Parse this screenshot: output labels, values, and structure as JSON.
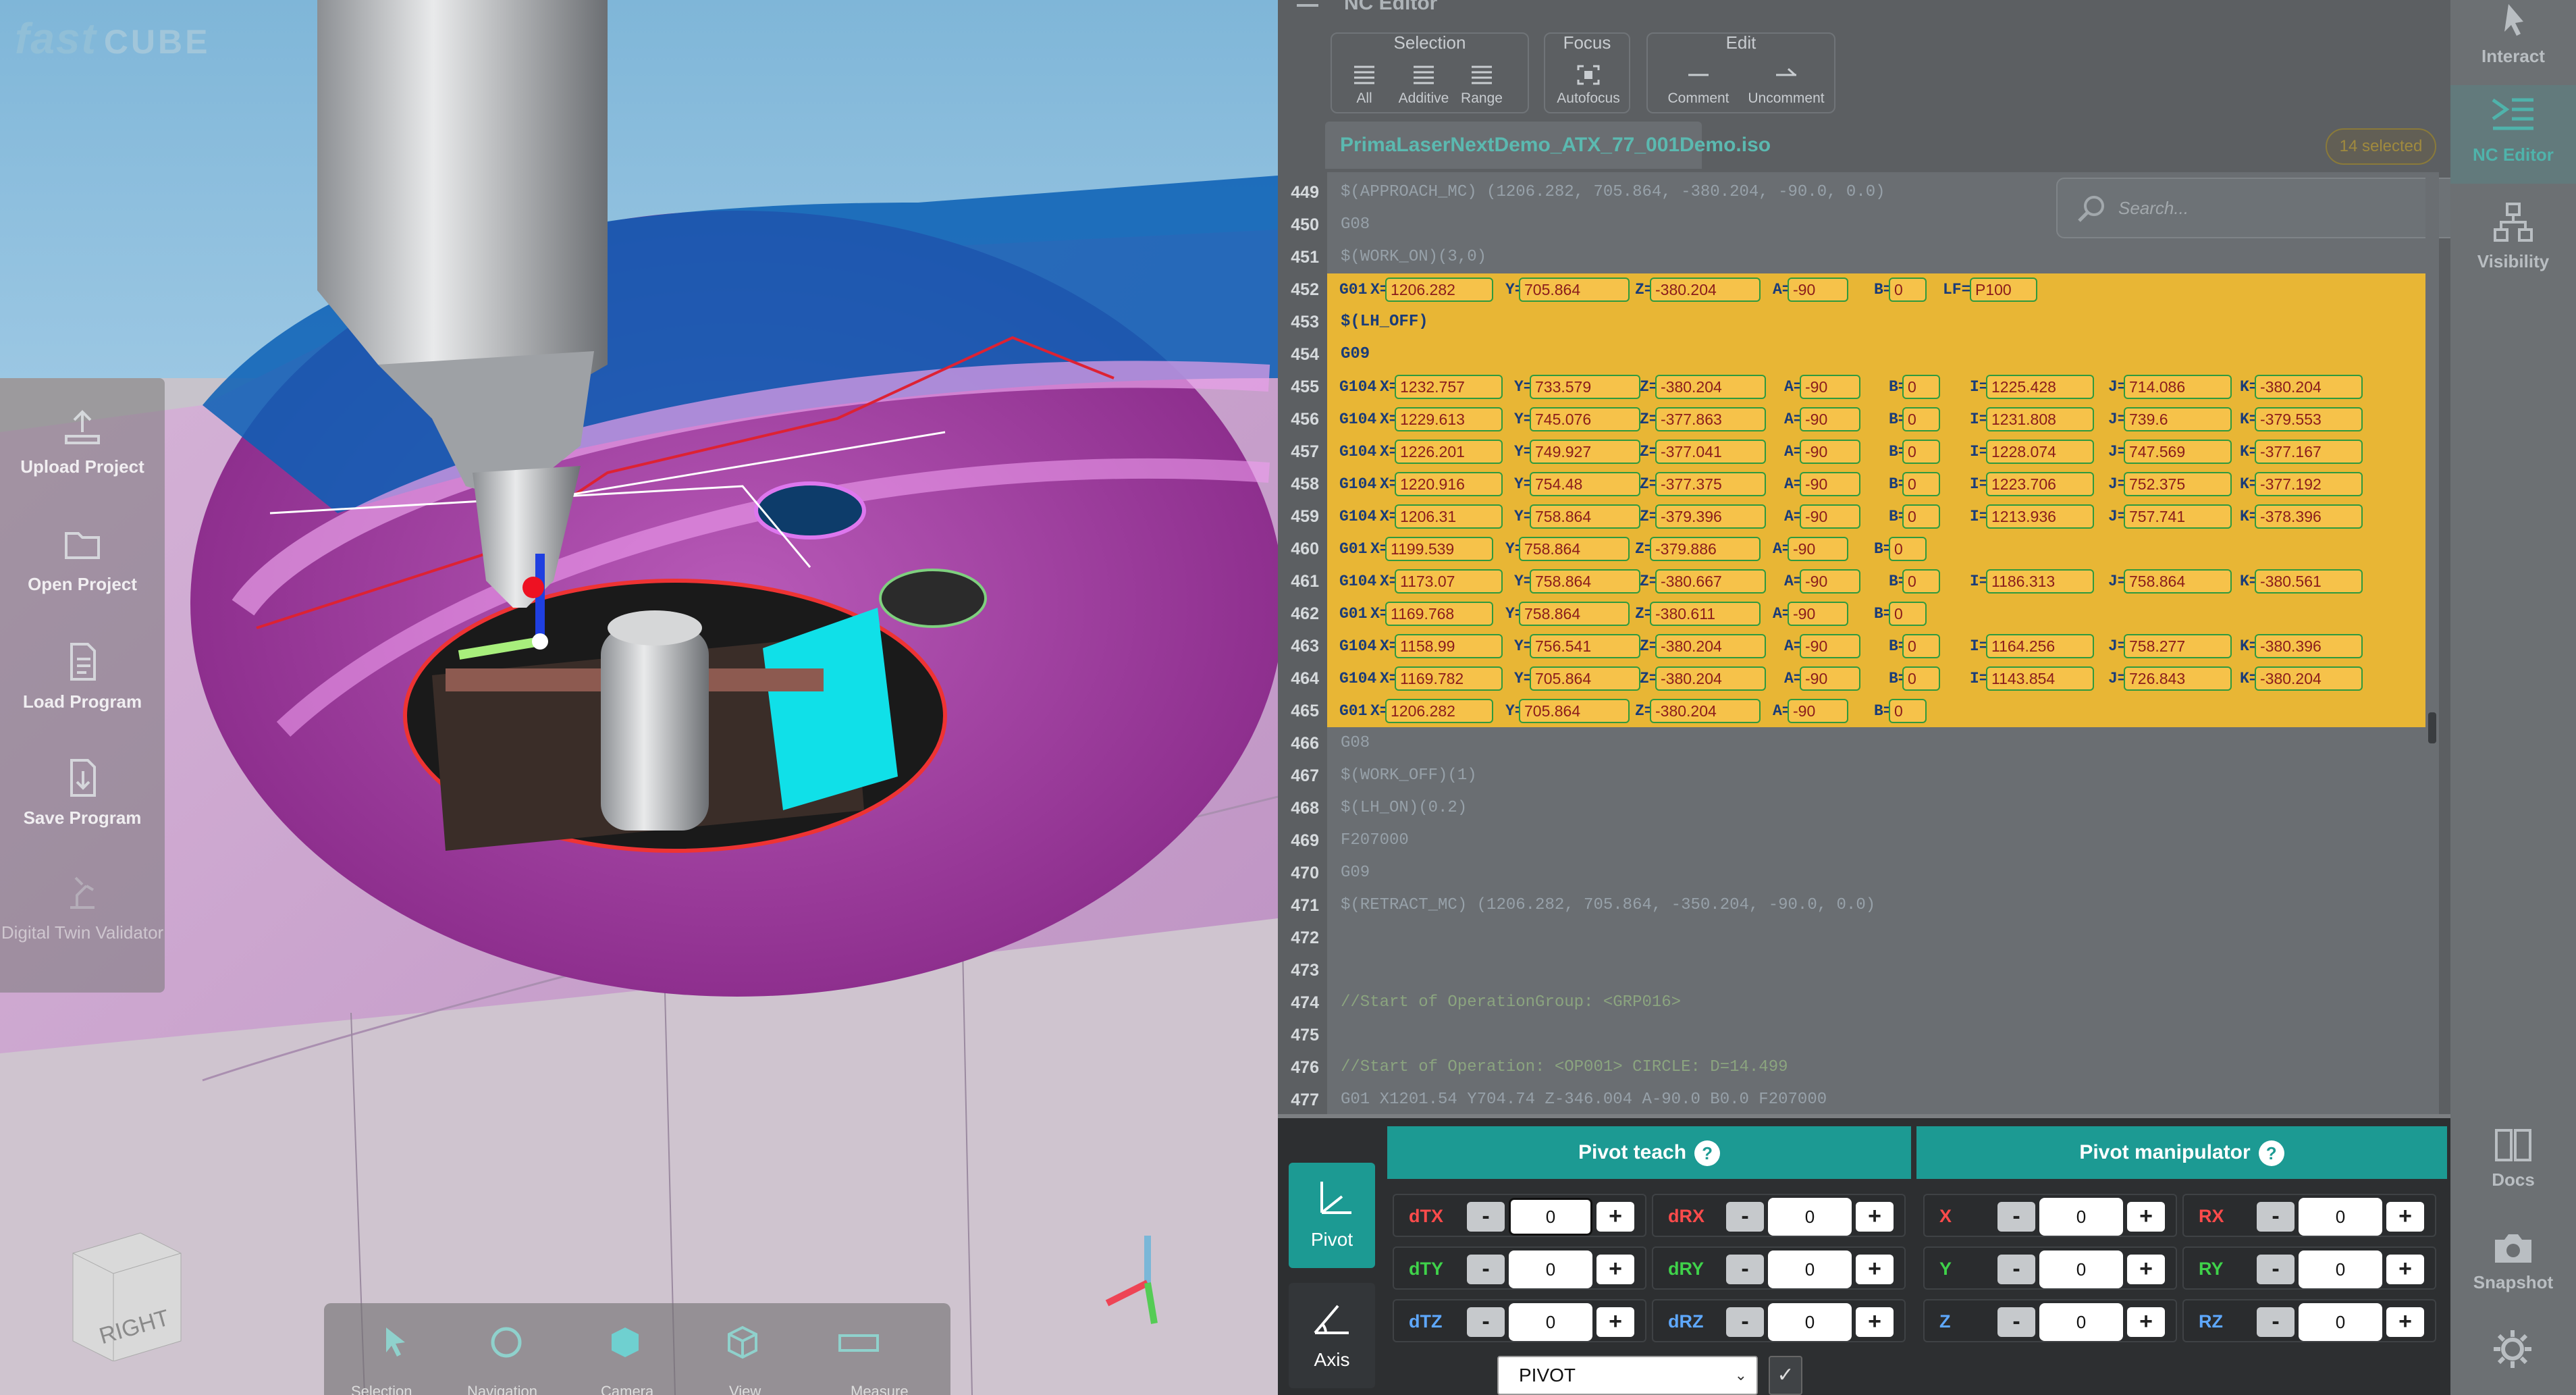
{
  "brand": {
    "name": "fast",
    "suffix": "CUBE"
  },
  "left_sidebar": {
    "items": [
      {
        "label": "Upload Project",
        "icon": "upload-icon"
      },
      {
        "label": "Open Project",
        "icon": "folder-icon"
      },
      {
        "label": "Load Program",
        "icon": "document-icon"
      },
      {
        "label": "Save Program",
        "icon": "save-icon"
      },
      {
        "label": "Digital Twin Validator",
        "icon": "robot-icon",
        "disabled": true
      }
    ]
  },
  "view_cube": {
    "face_label": "RIGHT"
  },
  "nc_editor": {
    "title": "NC Editor",
    "ribbon": {
      "groups": [
        {
          "title": "Selection",
          "buttons": [
            "All",
            "Additive",
            "Range"
          ]
        },
        {
          "title": "Focus",
          "buttons": [
            "Autofocus"
          ]
        },
        {
          "title": "Edit",
          "buttons": [
            "Comment",
            "Uncomment"
          ]
        }
      ]
    },
    "file_tab": "PrimaLaserNextDemo_ATX_77_001Demo.iso",
    "selected_badge": "14 selected",
    "search_placeholder": "Search...",
    "lines": [
      {
        "n": "449",
        "text": "$(APPROACH_MC) (1206.282, 705.864, -380.204, -90.0, 0.0)",
        "type": "plain"
      },
      {
        "n": "450",
        "text": "G08",
        "type": "plain"
      },
      {
        "n": "451",
        "text": "$(WORK_ON)(3,0)",
        "type": "plain"
      },
      {
        "n": "452",
        "cmd": "G01",
        "params": [
          [
            "X=",
            "1206.282"
          ],
          [
            "Y=",
            "705.864"
          ],
          [
            "Z=",
            "-380.204"
          ],
          [
            "A=",
            "-90"
          ],
          [
            "B=",
            "0"
          ],
          [
            "LF=",
            "P100"
          ]
        ],
        "type": "sel"
      },
      {
        "n": "453",
        "text": "$(LH_OFF)",
        "type": "seltext"
      },
      {
        "n": "454",
        "text": "G09",
        "type": "seltext"
      },
      {
        "n": "455",
        "cmd": "G104",
        "params": [
          [
            "X=",
            "1232.757"
          ],
          [
            "Y=",
            "733.579"
          ],
          [
            "Z=",
            "-380.204"
          ],
          [
            "A=",
            "-90"
          ],
          [
            "B=",
            "0"
          ],
          [
            "I=",
            "1225.428"
          ],
          [
            "J=",
            "714.086"
          ],
          [
            "K=",
            "-380.204"
          ]
        ],
        "type": "sel"
      },
      {
        "n": "456",
        "cmd": "G104",
        "params": [
          [
            "X=",
            "1229.613"
          ],
          [
            "Y=",
            "745.076"
          ],
          [
            "Z=",
            "-377.863"
          ],
          [
            "A=",
            "-90"
          ],
          [
            "B=",
            "0"
          ],
          [
            "I=",
            "1231.808"
          ],
          [
            "J=",
            "739.6"
          ],
          [
            "K=",
            "-379.553"
          ]
        ],
        "type": "sel"
      },
      {
        "n": "457",
        "cmd": "G104",
        "params": [
          [
            "X=",
            "1226.201"
          ],
          [
            "Y=",
            "749.927"
          ],
          [
            "Z=",
            "-377.041"
          ],
          [
            "A=",
            "-90"
          ],
          [
            "B=",
            "0"
          ],
          [
            "I=",
            "1228.074"
          ],
          [
            "J=",
            "747.569"
          ],
          [
            "K=",
            "-377.167"
          ]
        ],
        "type": "sel"
      },
      {
        "n": "458",
        "cmd": "G104",
        "params": [
          [
            "X=",
            "1220.916"
          ],
          [
            "Y=",
            "754.48"
          ],
          [
            "Z=",
            "-377.375"
          ],
          [
            "A=",
            "-90"
          ],
          [
            "B=",
            "0"
          ],
          [
            "I=",
            "1223.706"
          ],
          [
            "J=",
            "752.375"
          ],
          [
            "K=",
            "-377.192"
          ]
        ],
        "type": "sel"
      },
      {
        "n": "459",
        "cmd": "G104",
        "params": [
          [
            "X=",
            "1206.31"
          ],
          [
            "Y=",
            "758.864"
          ],
          [
            "Z=",
            "-379.396"
          ],
          [
            "A=",
            "-90"
          ],
          [
            "B=",
            "0"
          ],
          [
            "I=",
            "1213.936"
          ],
          [
            "J=",
            "757.741"
          ],
          [
            "K=",
            "-378.396"
          ]
        ],
        "type": "sel"
      },
      {
        "n": "460",
        "cmd": "G01",
        "params": [
          [
            "X=",
            "1199.539"
          ],
          [
            "Y=",
            "758.864"
          ],
          [
            "Z=",
            "-379.886"
          ],
          [
            "A=",
            "-90"
          ],
          [
            "B=",
            "0"
          ]
        ],
        "type": "sel"
      },
      {
        "n": "461",
        "cmd": "G104",
        "params": [
          [
            "X=",
            "1173.07"
          ],
          [
            "Y=",
            "758.864"
          ],
          [
            "Z=",
            "-380.667"
          ],
          [
            "A=",
            "-90"
          ],
          [
            "B=",
            "0"
          ],
          [
            "I=",
            "1186.313"
          ],
          [
            "J=",
            "758.864"
          ],
          [
            "K=",
            "-380.561"
          ]
        ],
        "type": "sel"
      },
      {
        "n": "462",
        "cmd": "G01",
        "params": [
          [
            "X=",
            "1169.768"
          ],
          [
            "Y=",
            "758.864"
          ],
          [
            "Z=",
            "-380.611"
          ],
          [
            "A=",
            "-90"
          ],
          [
            "B=",
            "0"
          ]
        ],
        "type": "sel"
      },
      {
        "n": "463",
        "cmd": "G104",
        "params": [
          [
            "X=",
            "1158.99"
          ],
          [
            "Y=",
            "756.541"
          ],
          [
            "Z=",
            "-380.204"
          ],
          [
            "A=",
            "-90"
          ],
          [
            "B=",
            "0"
          ],
          [
            "I=",
            "1164.256"
          ],
          [
            "J=",
            "758.277"
          ],
          [
            "K=",
            "-380.396"
          ]
        ],
        "type": "sel"
      },
      {
        "n": "464",
        "cmd": "G104",
        "params": [
          [
            "X=",
            "1169.782"
          ],
          [
            "Y=",
            "705.864"
          ],
          [
            "Z=",
            "-380.204"
          ],
          [
            "A=",
            "-90"
          ],
          [
            "B=",
            "0"
          ],
          [
            "I=",
            "1143.854"
          ],
          [
            "J=",
            "726.843"
          ],
          [
            "K=",
            "-380.204"
          ]
        ],
        "type": "sel"
      },
      {
        "n": "465",
        "cmd": "G01",
        "params": [
          [
            "X=",
            "1206.282"
          ],
          [
            "Y=",
            "705.864"
          ],
          [
            "Z=",
            "-380.204"
          ],
          [
            "A=",
            "-90"
          ],
          [
            "B=",
            "0"
          ]
        ],
        "type": "sel"
      },
      {
        "n": "466",
        "text": "G08",
        "type": "plain"
      },
      {
        "n": "467",
        "text": "$(WORK_OFF)(1)",
        "type": "plain"
      },
      {
        "n": "468",
        "text": "$(LH_ON)(0.2)",
        "type": "plain"
      },
      {
        "n": "469",
        "text": "F207000",
        "type": "plain"
      },
      {
        "n": "470",
        "text": "G09",
        "type": "plain"
      },
      {
        "n": "471",
        "text": "$(RETRACT_MC) (1206.282, 705.864, -350.204, -90.0, 0.0)",
        "type": "plain"
      },
      {
        "n": "472",
        "text": "",
        "type": "plain"
      },
      {
        "n": "473",
        "text": "",
        "type": "plain"
      },
      {
        "n": "474",
        "text": "//Start of OperationGroup: <GRP016>",
        "type": "comment"
      },
      {
        "n": "475",
        "text": "",
        "type": "plain"
      },
      {
        "n": "476",
        "text": "//Start of Operation: <OP001> CIRCLE: D=14.499",
        "type": "comment"
      },
      {
        "n": "477",
        "text": "G01 X1201.54 Y704.74 Z-346.004 A-90.0 B0.0 F207000",
        "type": "plain"
      }
    ]
  },
  "right_sidebar": {
    "items": [
      {
        "label": "Interact",
        "icon": "cursor-icon"
      },
      {
        "label": "NC Editor",
        "icon": "nc-editor-icon",
        "active": true
      },
      {
        "label": "Visibility",
        "icon": "hierarchy-icon"
      },
      {
        "label": "Docs",
        "icon": "book-icon"
      },
      {
        "label": "Snapshot",
        "icon": "camera-icon"
      }
    ]
  },
  "pivot_panel": {
    "side_buttons": [
      {
        "label": "Pivot",
        "icon": "pivot-icon",
        "active": true
      },
      {
        "label": "Axis",
        "icon": "axis-icon"
      }
    ],
    "teach": {
      "title": "Pivot teach",
      "help": "?",
      "fields": [
        {
          "label": "dTX",
          "value": "0",
          "color": "#ff4b4b"
        },
        {
          "label": "dRX",
          "value": "0",
          "color": "#ff4b4b"
        },
        {
          "label": "dTY",
          "value": "0",
          "color": "#3fd24a"
        },
        {
          "label": "dRY",
          "value": "0",
          "color": "#3fd24a"
        },
        {
          "label": "dTZ",
          "value": "0",
          "color": "#5ea8ff"
        },
        {
          "label": "dRZ",
          "value": "0",
          "color": "#5ea8ff"
        }
      ]
    },
    "manipulator": {
      "title": "Pivot manipulator",
      "help": "?",
      "fields": [
        {
          "label": "X",
          "value": "0",
          "color": "#ff4b4b"
        },
        {
          "label": "RX",
          "value": "0",
          "color": "#ff4b4b"
        },
        {
          "label": "Y",
          "value": "0",
          "color": "#3fd24a"
        },
        {
          "label": "RY",
          "value": "0",
          "color": "#3fd24a"
        },
        {
          "label": "Z",
          "value": "0",
          "color": "#5ea8ff"
        },
        {
          "label": "RZ",
          "value": "0",
          "color": "#5ea8ff"
        }
      ]
    },
    "minus": "-",
    "plus": "+",
    "pivot_select": "PIVOT",
    "confirm": "✓"
  },
  "bottom_toolbar": {
    "items": [
      "Selection",
      "Navigation",
      "Camera",
      "View",
      "Measure"
    ]
  }
}
